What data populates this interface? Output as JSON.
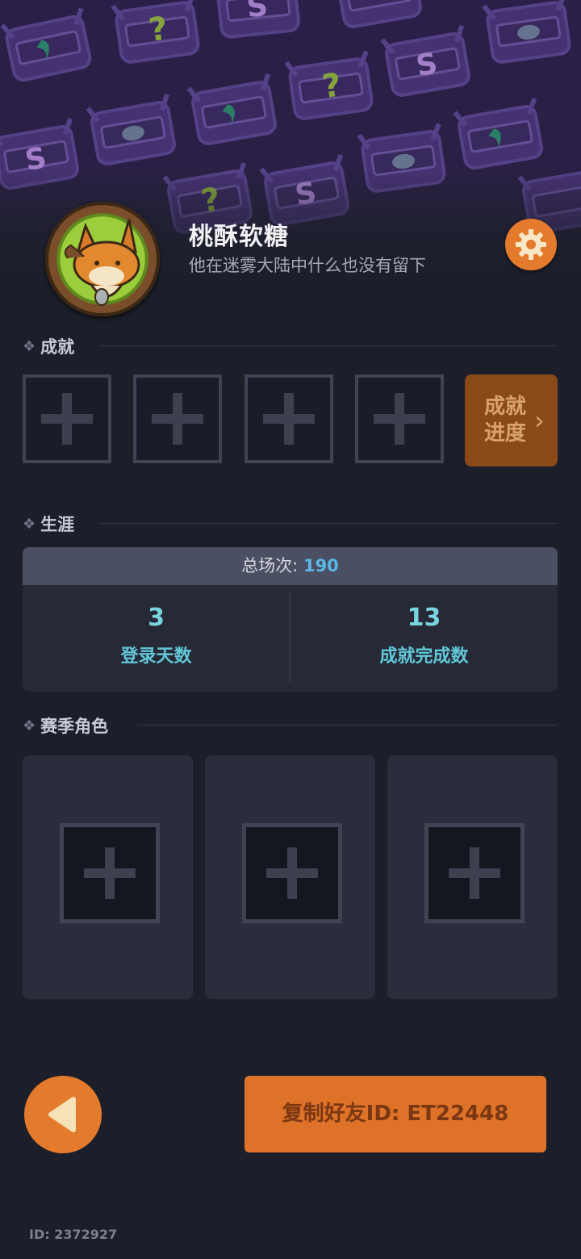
{
  "profile": {
    "name": "桃酥软糖",
    "bio": "他在迷雾大陆中什么也没有留下"
  },
  "icons": {
    "avatar": "fox-avatar-icon",
    "settings": "gear-icon",
    "back": "back-arrow-icon",
    "section_marker": "diamond-icon",
    "empty_slot": "plus-icon"
  },
  "achievements": {
    "title": "成就",
    "progress_label": "成就进度",
    "progress_chevron": "›"
  },
  "career": {
    "title": "生涯",
    "total_label": "总场次: ",
    "total_value": "190",
    "stats": [
      {
        "value": "3",
        "label": "登录天数"
      },
      {
        "value": "13",
        "label": "成就完成数"
      }
    ]
  },
  "season_roles": {
    "title": "赛季角色"
  },
  "footer": {
    "copy_button": "复制好友ID: ET22448",
    "player_id": "ID: 2372927"
  },
  "colors": {
    "accent_orange": "#e47a2c",
    "stat_cyan": "#62c7d8",
    "background": "#1c1f2a"
  }
}
